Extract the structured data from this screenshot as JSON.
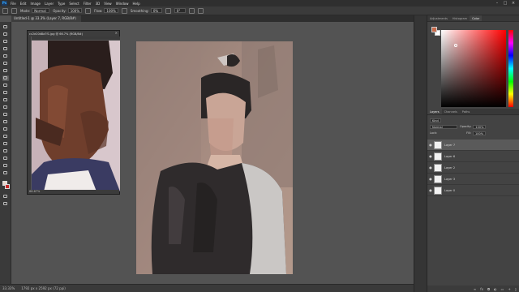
{
  "menu": {
    "app_logo": "Ps",
    "items": [
      "File",
      "Edit",
      "Image",
      "Layer",
      "Type",
      "Select",
      "Filter",
      "3D",
      "View",
      "Window",
      "Help"
    ]
  },
  "options": {
    "mode_label": "Mode:",
    "mode_value": "Normal",
    "opacity_label": "Opacity:",
    "opacity_value": "100%",
    "flow_label": "Flow:",
    "flow_value": "100%",
    "smoothing_label": "Smoothing:",
    "smoothing_value": "0%",
    "angle_value": "0°"
  },
  "document": {
    "tab_title": "Untitled-1 @ 33.3% (Layer 7, RGB/8#)",
    "zoom_status": "33.33%",
    "doc_status": "1792 px x 2592 px (72 ppi)"
  },
  "reference_window": {
    "title": "cc2e20d8a7f1.jpg @ 66.7% (RGB/8#)",
    "zoom": "66.67%"
  },
  "panels": {
    "tabs": [
      "Adjustments",
      "Histogram",
      "Color"
    ],
    "active_tab": "Color",
    "color": {
      "foreground": "#c96a4a",
      "background": "#ffffff"
    }
  },
  "layers_panel": {
    "tabs": [
      "Layers",
      "Channels",
      "Paths"
    ],
    "kind_label": "Kind",
    "blend_mode": "Normal",
    "opacity_label": "Opacity:",
    "opacity_value": "100%",
    "lock_label": "Lock:",
    "fill_label": "Fill:",
    "fill_value": "100%",
    "layers": [
      {
        "name": "Layer 7",
        "selected": true
      },
      {
        "name": "Layer 6",
        "selected": false
      },
      {
        "name": "Layer 2",
        "selected": false
      },
      {
        "name": "Layer 3",
        "selected": false
      },
      {
        "name": "Layer 0",
        "selected": false
      }
    ]
  },
  "accent_colors": {
    "ui_dark": "#2f2f2f",
    "ui_panel": "#434343",
    "canvas_bg": "#8b756b"
  }
}
